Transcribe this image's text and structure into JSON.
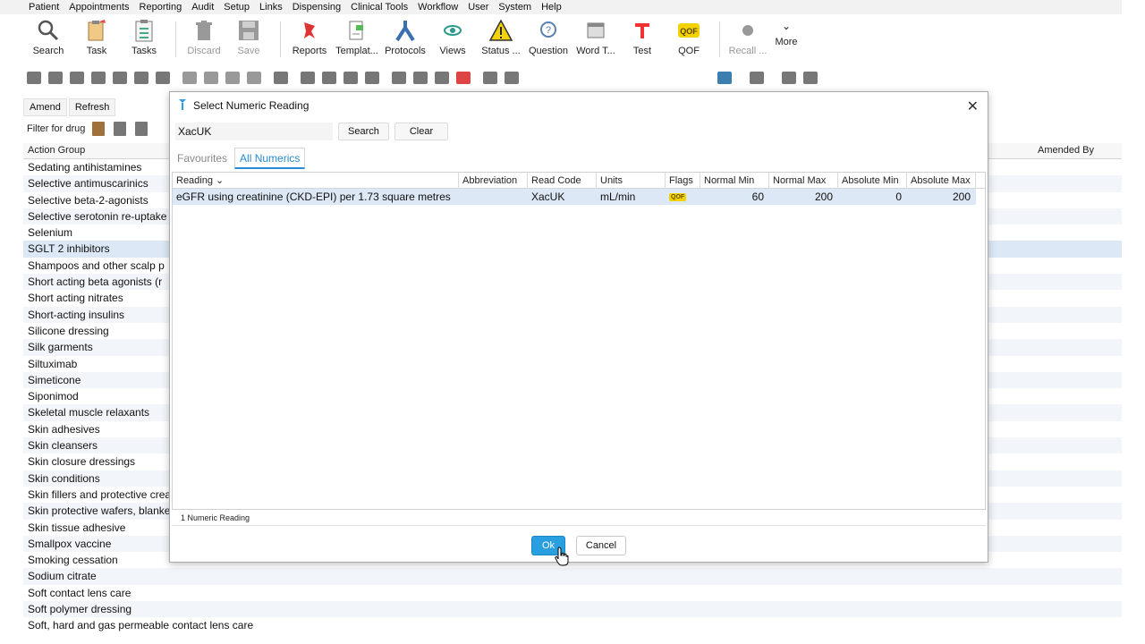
{
  "menu": [
    "Patient",
    "Appointments",
    "Reporting",
    "Audit",
    "Setup",
    "Links",
    "Dispensing",
    "Clinical Tools",
    "Workflow",
    "User",
    "System",
    "Help"
  ],
  "toolbar": {
    "search": "Search",
    "task": "Task",
    "tasks": "Tasks",
    "discard": "Discard",
    "save": "Save",
    "reports": "Reports",
    "templates": "Templat...",
    "protocols": "Protocols",
    "views": "Views",
    "status": "Status ...",
    "question": "Question",
    "word": "Word T...",
    "test": "Test",
    "qof": "QOF",
    "recall": "Recall ...",
    "more": "More"
  },
  "actions": {
    "amend": "Amend",
    "refresh": "Refresh"
  },
  "filter": {
    "label": "Filter for drug"
  },
  "bg_list": {
    "headers": {
      "action_group": "Action Group",
      "amended_by": "Amended By"
    },
    "rows": [
      "Sedating antihistamines",
      "Selective antimuscarinics",
      "Selective beta-2-agonists",
      "Selective serotonin re-uptake",
      "Selenium",
      "SGLT 2 inhibitors",
      "Shampoos and other scalp p",
      "Short acting beta agonists (r",
      "Short acting nitrates",
      "Short-acting insulins",
      "Silicone dressing",
      "Silk garments",
      "Siltuximab",
      "Simeticone",
      "Siponimod",
      "Skeletal muscle relaxants",
      "Skin adhesives",
      "Skin cleansers",
      "Skin closure dressings",
      "Skin conditions",
      "Skin fillers and protective crea",
      "Skin protective wafers, blanket",
      "Skin tissue adhesive",
      "Smallpox vaccine",
      "Smoking cessation",
      "Sodium citrate",
      "Soft contact lens care",
      "Soft polymer dressing",
      "Soft, hard and gas permeable contact lens care"
    ],
    "selected_index": 5
  },
  "dialog": {
    "title": "Select Numeric Reading",
    "search_value": "XacUK",
    "search_btn": "Search",
    "clear_btn": "Clear",
    "tabs": [
      "Favourites",
      "All Numerics"
    ],
    "active_tab": 1,
    "columns": [
      "Reading",
      "Abbreviation",
      "Read Code",
      "Units",
      "Flags",
      "Normal Min",
      "Normal Max",
      "Absolute Min",
      "Absolute Max"
    ],
    "sort_indicator": "⌄",
    "row": {
      "reading": "eGFR using creatinine (CKD-EPI) per 1.73 square metres",
      "abbreviation": "",
      "read_code": "XacUK",
      "units": "mL/min",
      "flag": "QOF",
      "normal_min": "60",
      "normal_max": "200",
      "absolute_min": "0",
      "absolute_max": "200"
    },
    "status": "1 Numeric Reading",
    "ok": "Ok",
    "cancel": "Cancel"
  },
  "colors": {
    "accent": "#2a9fe0",
    "selection": "#dce8f5",
    "qof": "#f2d200"
  }
}
